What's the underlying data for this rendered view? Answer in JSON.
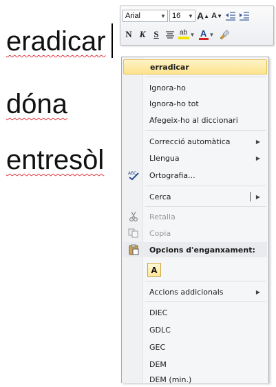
{
  "document": {
    "words": [
      "eradicar",
      "dóna",
      "entresòl"
    ]
  },
  "mini_toolbar": {
    "font_name": "Arial",
    "font_size": "16",
    "grow_font": "A",
    "shrink_font": "A",
    "bold": "N",
    "italic": "K",
    "underline": "S",
    "highlight": "ab",
    "font_color": "A"
  },
  "menu": {
    "suggestion": "erradicar",
    "ignore": "Ignora-ho",
    "ignore_all": "Ignora-ho tot",
    "add_dictionary": "Afegeix-ho al diccionari",
    "autocorrect": "Correcció automàtica",
    "language": "Llengua",
    "spelling": "Ortografia...",
    "search": "Cerca",
    "cut": "Retalla",
    "copy": "Copia",
    "paste_options": "Opcions d'enganxament:",
    "paste_keep_text": "A",
    "additional_actions": "Accions addicionals",
    "dicts": [
      "DIEC",
      "GDLC",
      "GEC",
      "DEM",
      "DEM (min.)"
    ]
  },
  "colors": {
    "highlight_bg": "#fde38a",
    "spell_underline": "#e0353d",
    "font_color_bar": "#d42020",
    "highlight_bar": "#f5e200"
  },
  "icons": [
    "spelling-check-icon",
    "scissors-icon",
    "copy-icon",
    "clipboard-icon",
    "paintbrush-icon",
    "bullets-icon"
  ]
}
